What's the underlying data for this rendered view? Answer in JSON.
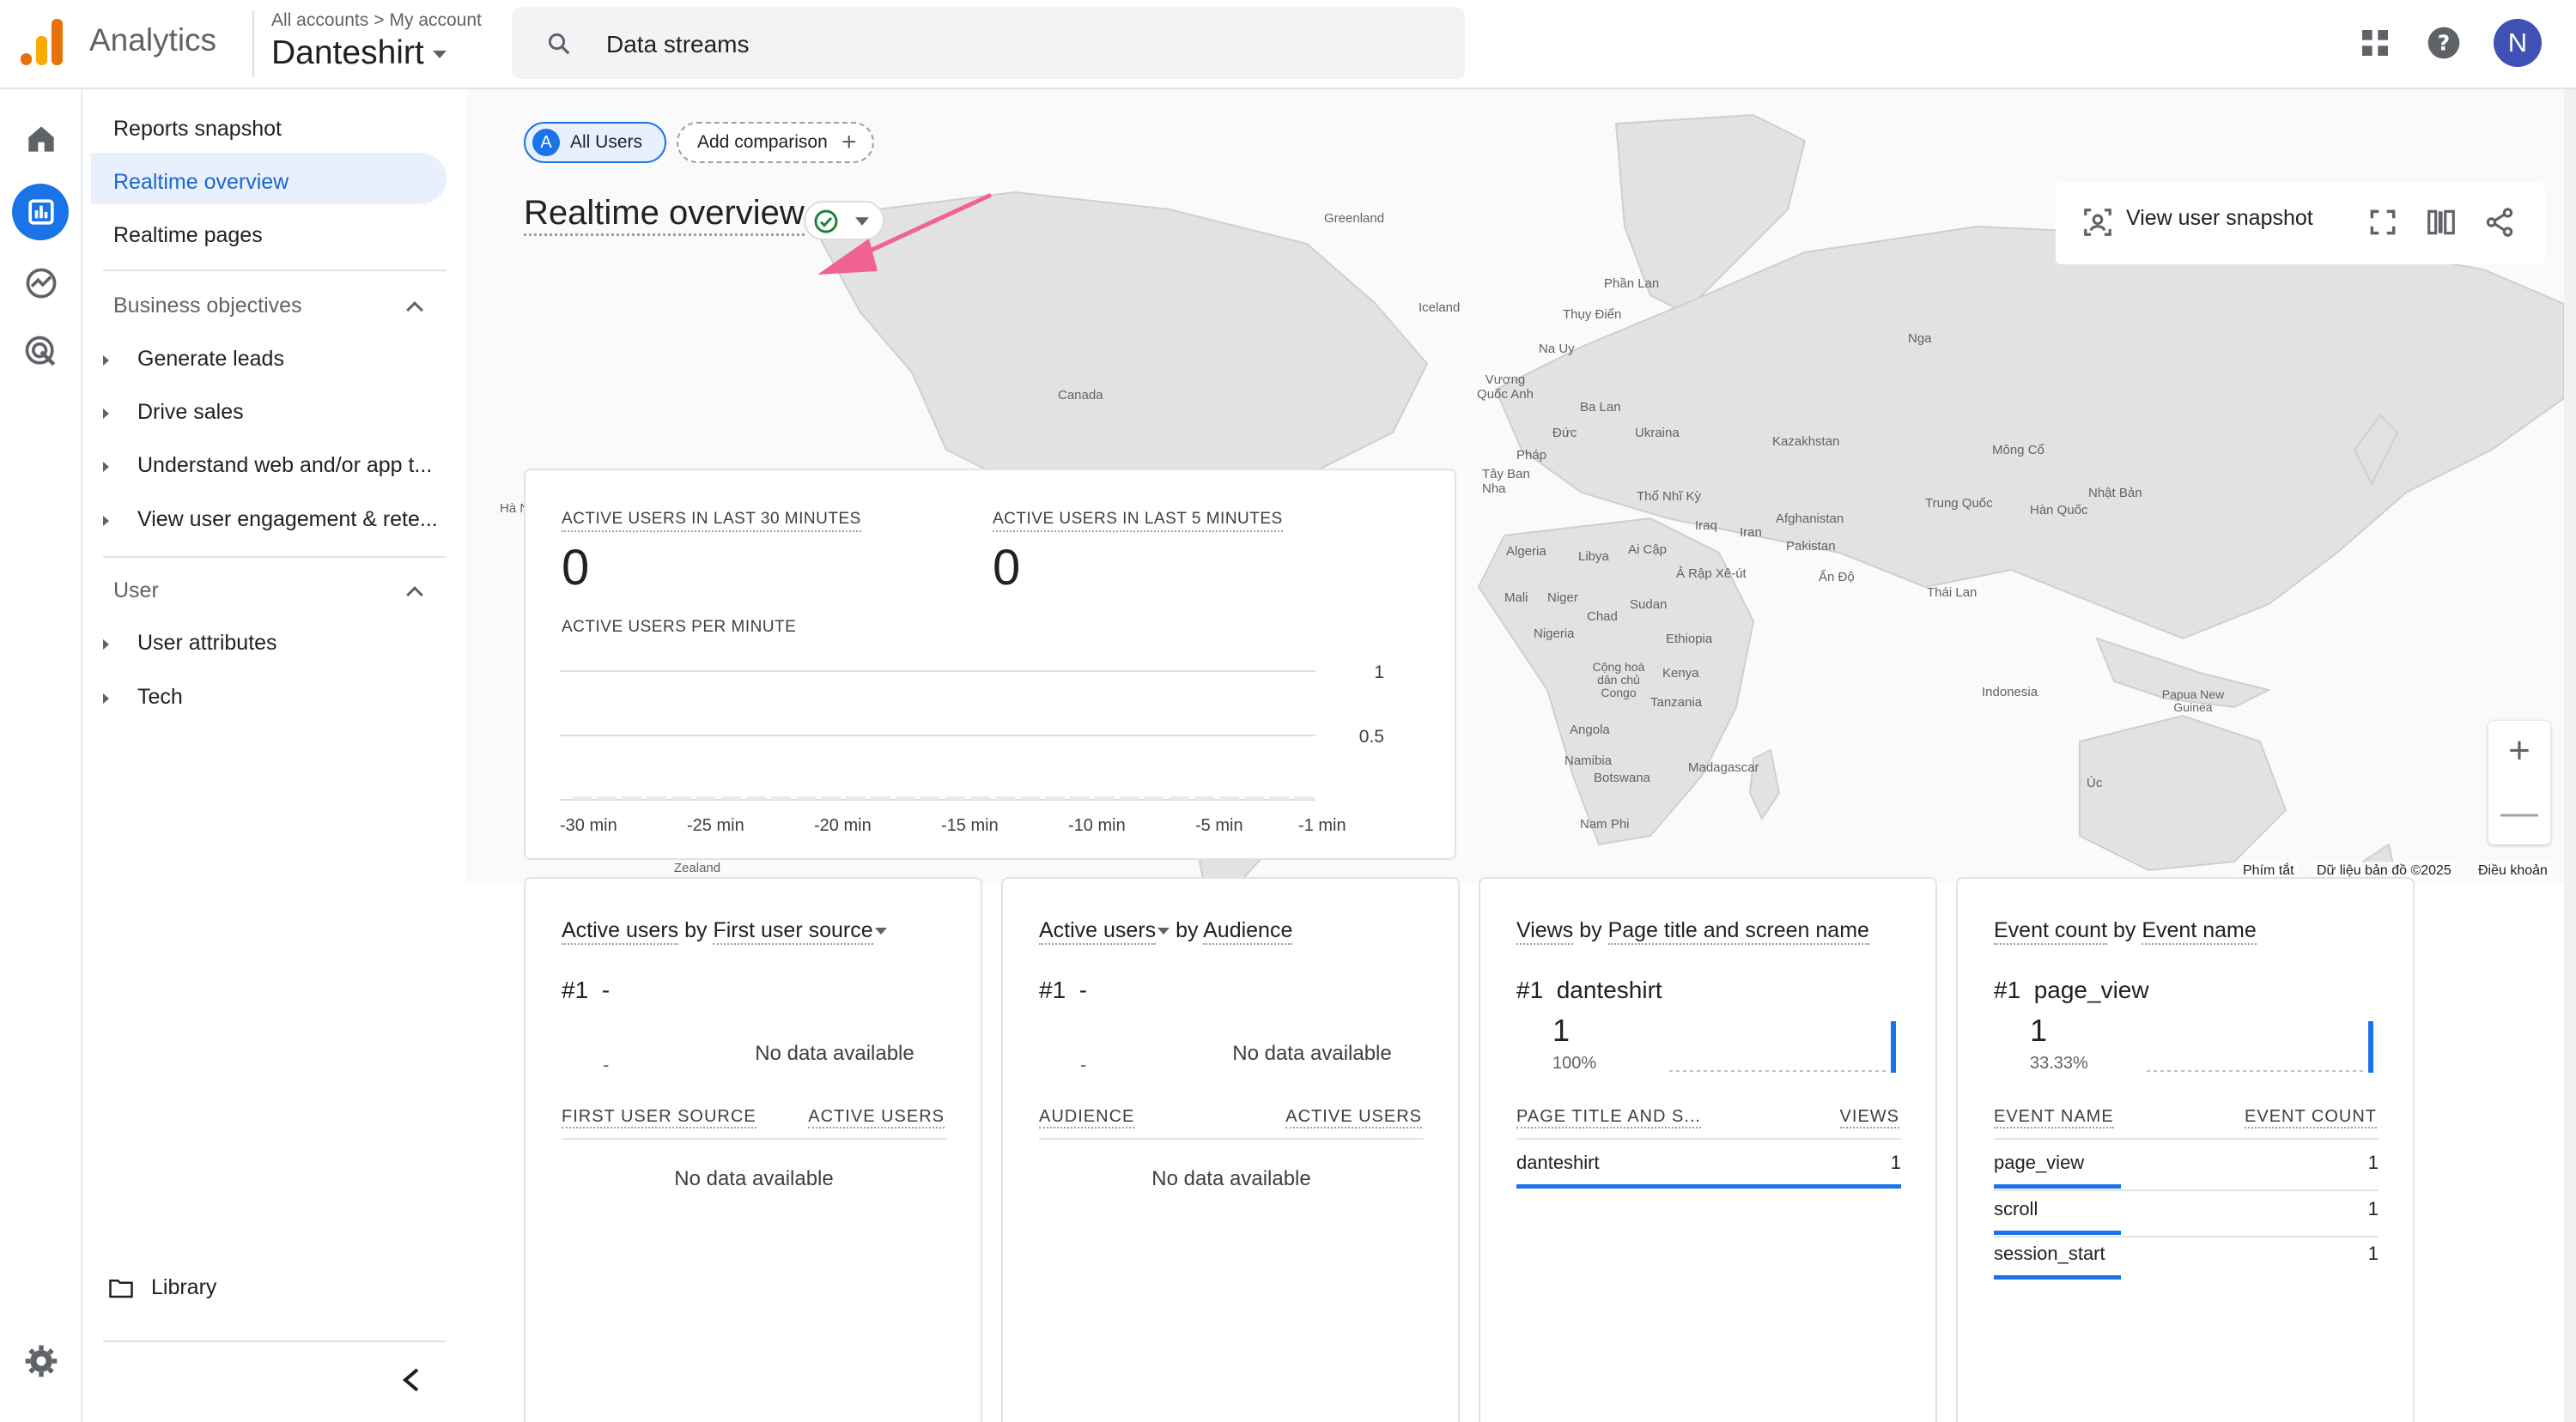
{
  "app": {
    "product": "Analytics",
    "breadcrumb": [
      "All accounts",
      "My account"
    ],
    "account": "Danteshirt",
    "search_text": "Data streams",
    "avatar_letter": "N"
  },
  "sidenav": {
    "top_items": [
      "Reports snapshot",
      "Realtime overview",
      "Realtime pages"
    ],
    "active": "Realtime overview",
    "sections": [
      {
        "title": "Business objectives",
        "items": [
          "Generate leads",
          "Drive sales",
          "Understand web and/or app t...",
          "View user engagement & rete..."
        ]
      },
      {
        "title": "User",
        "items": [
          "User attributes",
          "Tech"
        ]
      }
    ],
    "library": "Library"
  },
  "comparison": {
    "all_users_badge": "A",
    "all_users": "All Users",
    "add_comparison": "Add comparison"
  },
  "page": {
    "title": "Realtime overview",
    "view_user_snapshot": "View user snapshot"
  },
  "map": {
    "labels": [
      "Greenland",
      "Iceland",
      "Phần Lan",
      "Thụy Điển",
      "Na Uy",
      "Nga",
      "Vương Quốc Anh",
      "Ba Lan",
      "Đức",
      "Ukraina",
      "Pháp",
      "Kazakhstan",
      "Mông Cổ",
      "Tây Ban Nha",
      "Thổ Nhĩ Kỳ",
      "Afghanistan",
      "Trung Quốc",
      "Nhật Bản",
      "Hàn Quốc",
      "Iraq",
      "Iran",
      "Pakistan",
      "Canada",
      "Algeria",
      "Libya",
      "Ai Cập",
      "Ả Rập Xê-út",
      "Ấn Độ",
      "Thái Lan",
      "Mali",
      "Niger",
      "Chad",
      "Sudan",
      "Nigeria",
      "Ethiopia",
      "Cộng hoà dân chủ Congo",
      "Kenya",
      "Tanzania",
      "Indonesia",
      "Papua New Guinea",
      "Angola",
      "Namibia",
      "Botswana",
      "Madagascar",
      "Úc",
      "Nam Phi",
      "New Zealand",
      "Hà Nội"
    ],
    "footer": [
      "Phím tắt",
      "Dữ liệu bản đồ ©2025",
      "Điều khoản"
    ],
    "zoom_in": "+",
    "zoom_out": "—"
  },
  "realtime_card": {
    "metric_30_label": "ACTIVE USERS IN LAST 30 MINUTES",
    "metric_30_value": "0",
    "metric_5_label": "ACTIVE USERS IN LAST 5 MINUTES",
    "metric_5_value": "0",
    "per_minute_label": "ACTIVE USERS PER MINUTE"
  },
  "chart_data": {
    "type": "bar",
    "title": "ACTIVE USERS PER MINUTE",
    "categories": [
      "-30 min",
      "-25 min",
      "-20 min",
      "-15 min",
      "-10 min",
      "-5 min",
      "-1 min"
    ],
    "values": [
      0,
      0,
      0,
      0,
      0,
      0,
      0
    ],
    "y_ticks": [
      "1",
      "0.5"
    ],
    "ylim": [
      0,
      1
    ]
  },
  "cards": [
    {
      "metric": "Active users",
      "by": "by",
      "dimension": "First user source",
      "dropdown_on": "dimension",
      "rank": "#1",
      "top_value": "-",
      "spark_dash": "-",
      "no_data": "No data available",
      "col1": "FIRST USER SOURCE",
      "col2": "ACTIVE USERS",
      "rows": [],
      "table_no_data": "No data available"
    },
    {
      "metric": "Active users",
      "by": "by",
      "dimension": "Audience",
      "dropdown_on": "metric",
      "rank": "#1",
      "top_value": "-",
      "spark_dash": "-",
      "no_data": "No data available",
      "col1": "AUDIENCE",
      "col2": "ACTIVE USERS",
      "rows": [],
      "table_no_data": "No data available"
    },
    {
      "metric": "Views",
      "by": "by",
      "dimension": "Page title and screen name",
      "rank": "#1",
      "top_value": "danteshirt",
      "big_value": "1",
      "big_pct": "100%",
      "col1": "PAGE TITLE AND S...",
      "col2": "VIEWS",
      "rows": [
        {
          "name": "danteshirt",
          "value": "1",
          "share": 1.0
        }
      ]
    },
    {
      "metric": "Event count",
      "by": "by",
      "dimension": "Event name",
      "rank": "#1",
      "top_value": "page_view",
      "big_value": "1",
      "big_pct": "33.33%",
      "col1": "EVENT NAME",
      "col2": "EVENT COUNT",
      "rows": [
        {
          "name": "page_view",
          "value": "1",
          "share": 0.33
        },
        {
          "name": "scroll",
          "value": "1",
          "share": 0.33
        },
        {
          "name": "session_start",
          "value": "1",
          "share": 0.33
        }
      ]
    }
  ],
  "colors": {
    "accent": "#1a73e8",
    "active_nav_bg": "#e8f0fe",
    "annotation_arrow": "#f06292",
    "logo_orange": "#e8710a",
    "logo_yellow": "#f9ab00"
  }
}
